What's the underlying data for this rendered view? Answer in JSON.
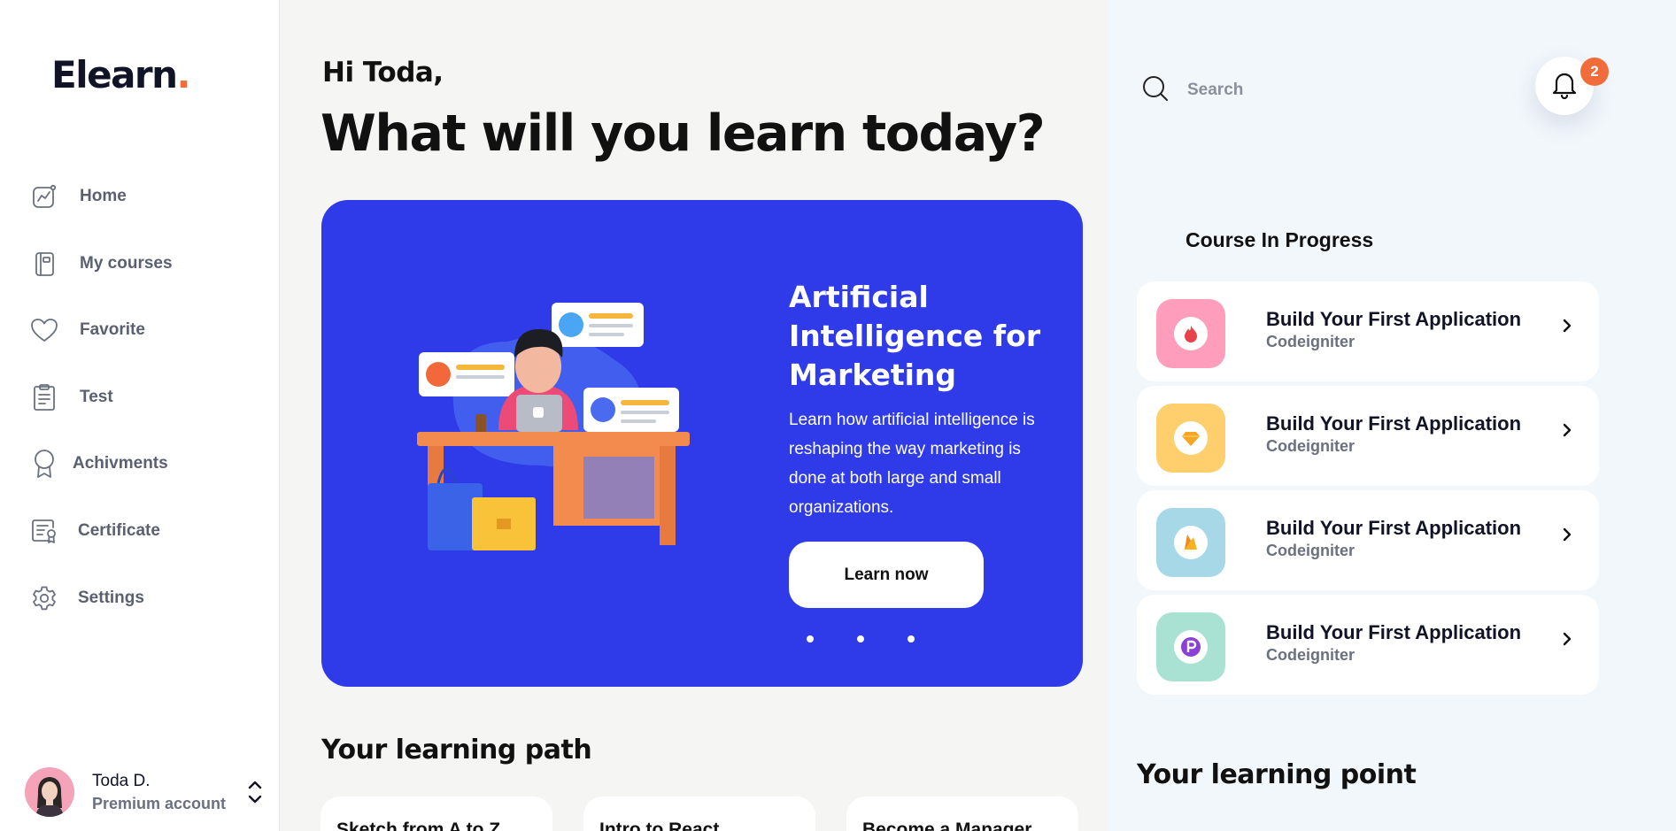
{
  "brand": {
    "name": "Elearn",
    "dot": ".",
    "accent": "#f26b3a"
  },
  "nav": {
    "items": [
      {
        "label": "Home",
        "icon": "chart-line-icon"
      },
      {
        "label": "My courses",
        "icon": "book-icon"
      },
      {
        "label": "Favorite",
        "icon": "heart-icon"
      },
      {
        "label": "Test",
        "icon": "clipboard-icon"
      },
      {
        "label": "Achivments",
        "icon": "award-icon"
      },
      {
        "label": "Certificate",
        "icon": "certificate-icon"
      },
      {
        "label": "Settings",
        "icon": "gear-icon"
      }
    ]
  },
  "user": {
    "name": "Toda D.",
    "role": "Premium account"
  },
  "main": {
    "greeting": "Hi Toda,",
    "headline": "What will you learn today?",
    "hero": {
      "title": "Artificial Intelligence for Marketing",
      "description": "Learn how artificial intelligence is reshaping the way marketing is done at both large and small organizations.",
      "button": "Learn now",
      "bg_color": "#2f3be8",
      "slides": 3
    },
    "learning_path": {
      "title": "Your learning path",
      "cards": [
        "Sketch from A to Z",
        "Intro to React",
        "Become a Manager"
      ]
    }
  },
  "right": {
    "search": {
      "placeholder": "Search"
    },
    "notifications": {
      "count": "2"
    },
    "course_in_progress": {
      "title": "Course In Progress",
      "courses": [
        {
          "name": "Build Your First Application",
          "sub": "Codeigniter",
          "icon": "flame-icon",
          "color": "#ff9ebc"
        },
        {
          "name": "Build Your First Application",
          "sub": "Codeigniter",
          "icon": "diamond-icon",
          "color": "#ffcf6e"
        },
        {
          "name": "Build Your First Application",
          "sub": "Codeigniter",
          "icon": "firebase-icon",
          "color": "#a6d8e8"
        },
        {
          "name": "Build Your First Application",
          "sub": "Codeigniter",
          "icon": "p-logo-icon",
          "color": "#a9e2d2"
        }
      ]
    },
    "learning_point": {
      "title": "Your learning point"
    }
  }
}
